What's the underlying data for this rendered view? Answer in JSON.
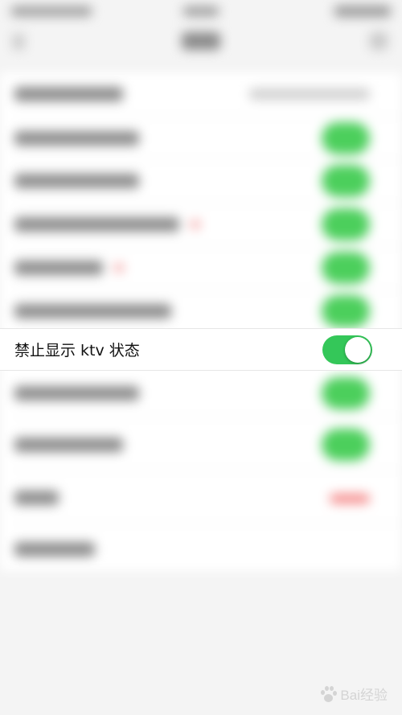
{
  "focused_setting": {
    "label": "禁止显示 ktv 状态",
    "toggle_on": true,
    "toggle_color": "#34c759"
  },
  "watermark": {
    "text": "Bai经验",
    "color": "#d4d4d4"
  },
  "colors": {
    "accent_green": "#34c759",
    "background": "#f4f4f4",
    "list_background": "#ffffff"
  },
  "icons": [
    "back-arrow-icon",
    "more-icon",
    "baidu-paw-icon"
  ]
}
